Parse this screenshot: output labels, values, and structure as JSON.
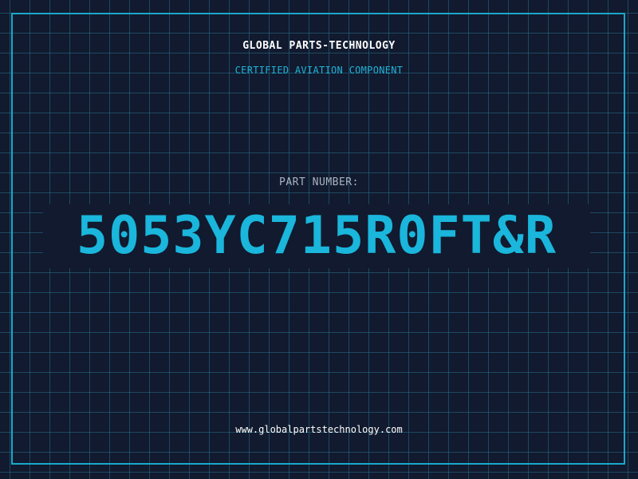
{
  "header": {
    "company": "GLOBAL PARTS-TECHNOLOGY",
    "tagline": "CERTIFIED AVIATION COMPONENT"
  },
  "part": {
    "label": "PART NUMBER:",
    "number": "5053YC715R0FT&R"
  },
  "footer": {
    "url": "www.globalpartstechnology.com"
  },
  "colors": {
    "background": "#111a2e",
    "accent": "#1ab6dc",
    "grid": "#286e8c",
    "text": "#ffffff"
  }
}
